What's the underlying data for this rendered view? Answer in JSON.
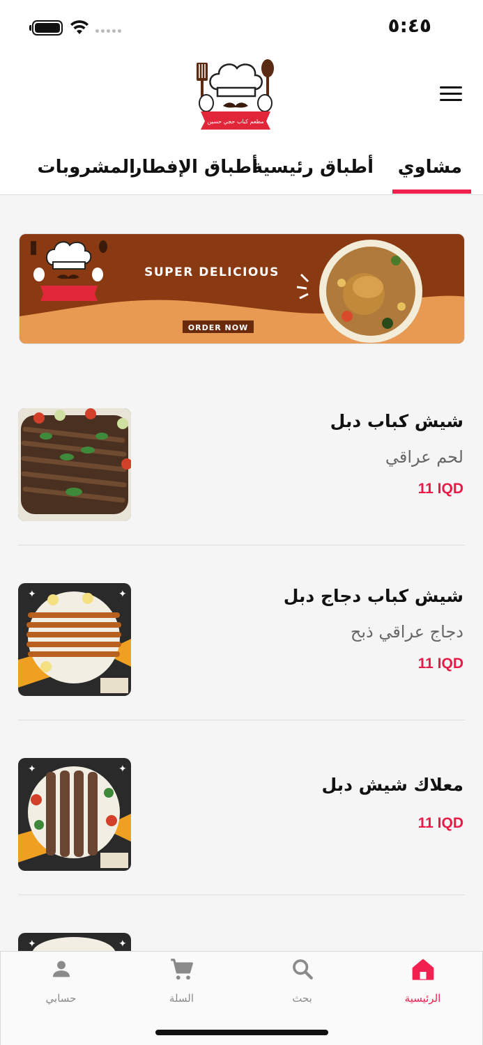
{
  "status_bar": {
    "time": "٥:٤٥"
  },
  "logo": {
    "caption": "مطعم كباب حجي حسين"
  },
  "tabs": [
    {
      "label": "مشاوي",
      "active": true
    },
    {
      "label": "أطباق رئيسية",
      "active": false
    },
    {
      "label": "أطباق الإفطار",
      "active": false
    },
    {
      "label": "المشروبات",
      "active": false
    }
  ],
  "banner": {
    "headline": "SUPER DELICIOUS",
    "cta": "ORDER NOW",
    "colors": {
      "top": "#8a3a12",
      "bottom": "#e89a52"
    }
  },
  "menu_items": [
    {
      "name": "شيش كباب دبل",
      "description": "لحم عراقي",
      "price": "11 IQD"
    },
    {
      "name": "شيش كباب دجاج دبل",
      "description": "دجاج عراقي ذبح",
      "price": "11 IQD"
    },
    {
      "name": "معلاك شيش دبل",
      "description": "",
      "price": "11 IQD"
    }
  ],
  "bottom_nav": [
    {
      "label": "حسابي",
      "icon": "person-icon",
      "active": false
    },
    {
      "label": "السلة",
      "icon": "cart-icon",
      "active": false
    },
    {
      "label": "بحث",
      "icon": "search-icon",
      "active": false
    },
    {
      "label": "الرئيسية",
      "icon": "home-icon",
      "active": true
    }
  ],
  "colors": {
    "accent": "#f0204f",
    "price": "#e81a48",
    "inactive": "#8a8a8a"
  }
}
